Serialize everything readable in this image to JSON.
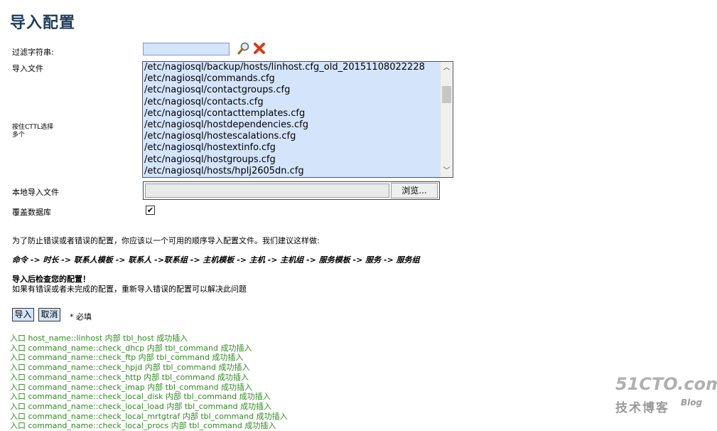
{
  "page": {
    "title": "导入配置"
  },
  "form": {
    "filter_label": "过滤字符串:",
    "filter_value": "",
    "import_file_label": "导入文件",
    "ctrl_hint_line1": "按住CTTL选择",
    "ctrl_hint_line2": "多个",
    "files": [
      "/etc/nagiosql/backup/hosts/linhost.cfg_old_20151108022228",
      "/etc/nagiosql/commands.cfg",
      "/etc/nagiosql/contactgroups.cfg",
      "/etc/nagiosql/contacts.cfg",
      "/etc/nagiosql/contacttemplates.cfg",
      "/etc/nagiosql/hostdependencies.cfg",
      "/etc/nagiosql/hostescalations.cfg",
      "/etc/nagiosql/hostextinfo.cfg",
      "/etc/nagiosql/hostgroups.cfg",
      "/etc/nagiosql/hosts/hplj2605dn.cfg"
    ],
    "local_file_label": "本地导入文件",
    "browse_label": "浏览...",
    "overwrite_label": "覆盖数据库",
    "overwrite_checked": true,
    "overwrite_mark": "✔"
  },
  "info": {
    "order_text": "为了防止错误或者错误的配置，你应该以一个可用的顺序导入配置文件。我们建议这样做:",
    "chain": "命令 -> 时长 -> 联系人模板 -> 联系人 ->联系组 -> 主机模板 -> 主机 -> 主机组 -> 服务模板 -> 服务 -> 服务组",
    "check_title": "导入后检查您的配置！",
    "check_text": "如果有错误或者未完成的配置，重新导入错误的配置可以解决此问题"
  },
  "actions": {
    "import_label": "导入",
    "cancel_label": "取消",
    "required_note": "* 必填"
  },
  "log": [
    "入口 host_name::linhost 内部 tbl_host 成功插入",
    "入口 command_name::check_dhcp 内部 tbl_command 成功插入",
    "入口 command_name::check_ftp 内部 tbl_command 成功插入",
    "入口 command_name::check_hpjd 内部 tbl_command 成功插入",
    "入口 command_name::check_http 内部 tbl_command 成功插入",
    "入口 command_name::check_imap 内部 tbl_command 成功插入",
    "入口 command_name::check_local_disk 内部 tbl_command 成功插入",
    "入口 command_name::check_local_load 内部 tbl_command 成功插入",
    "入口 command_name::check_local_mrtgtraf 内部 tbl_command 成功插入",
    "入口 command_name::check_local_procs 内部 tbl_command 成功插入"
  ],
  "watermark": {
    "site": "51CTO.com",
    "cn": "技术博客",
    "blog": "Blog"
  }
}
